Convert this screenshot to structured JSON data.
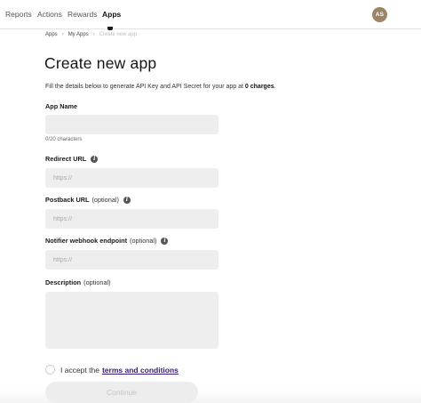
{
  "nav": {
    "items": [
      {
        "label": "Reports",
        "active": false
      },
      {
        "label": "Actions",
        "active": false
      },
      {
        "label": "Rewards",
        "active": false
      },
      {
        "label": "Apps",
        "active": true
      }
    ],
    "avatar_initials": "AS"
  },
  "breadcrumb": {
    "items": [
      "Apps",
      "My Apps",
      "Create new app"
    ],
    "separator": "›"
  },
  "page": {
    "title": "Create new app",
    "intro_prefix": "Fill the details below to generate API Key and API Secret for your app at",
    "intro_charges": "0 charges",
    "intro_suffix": "."
  },
  "form": {
    "app_name": {
      "label": "App Name",
      "value": "",
      "char_count": "0/20 characters"
    },
    "redirect_url": {
      "label": "Redirect URL",
      "placeholder": "https://"
    },
    "postback_url": {
      "label": "Postback URL",
      "optional": "(optional)",
      "placeholder": "https://"
    },
    "notifier": {
      "label": "Notifier webhook endpoint",
      "optional": "(optional)",
      "placeholder": "https://"
    },
    "description": {
      "label": "Description",
      "optional": "(optional)"
    },
    "terms_prefix": "I accept the",
    "terms_link": "terms and conditions",
    "continue_label": "Continue"
  },
  "icons": {
    "info": "info-icon",
    "info_glyph": "i"
  }
}
